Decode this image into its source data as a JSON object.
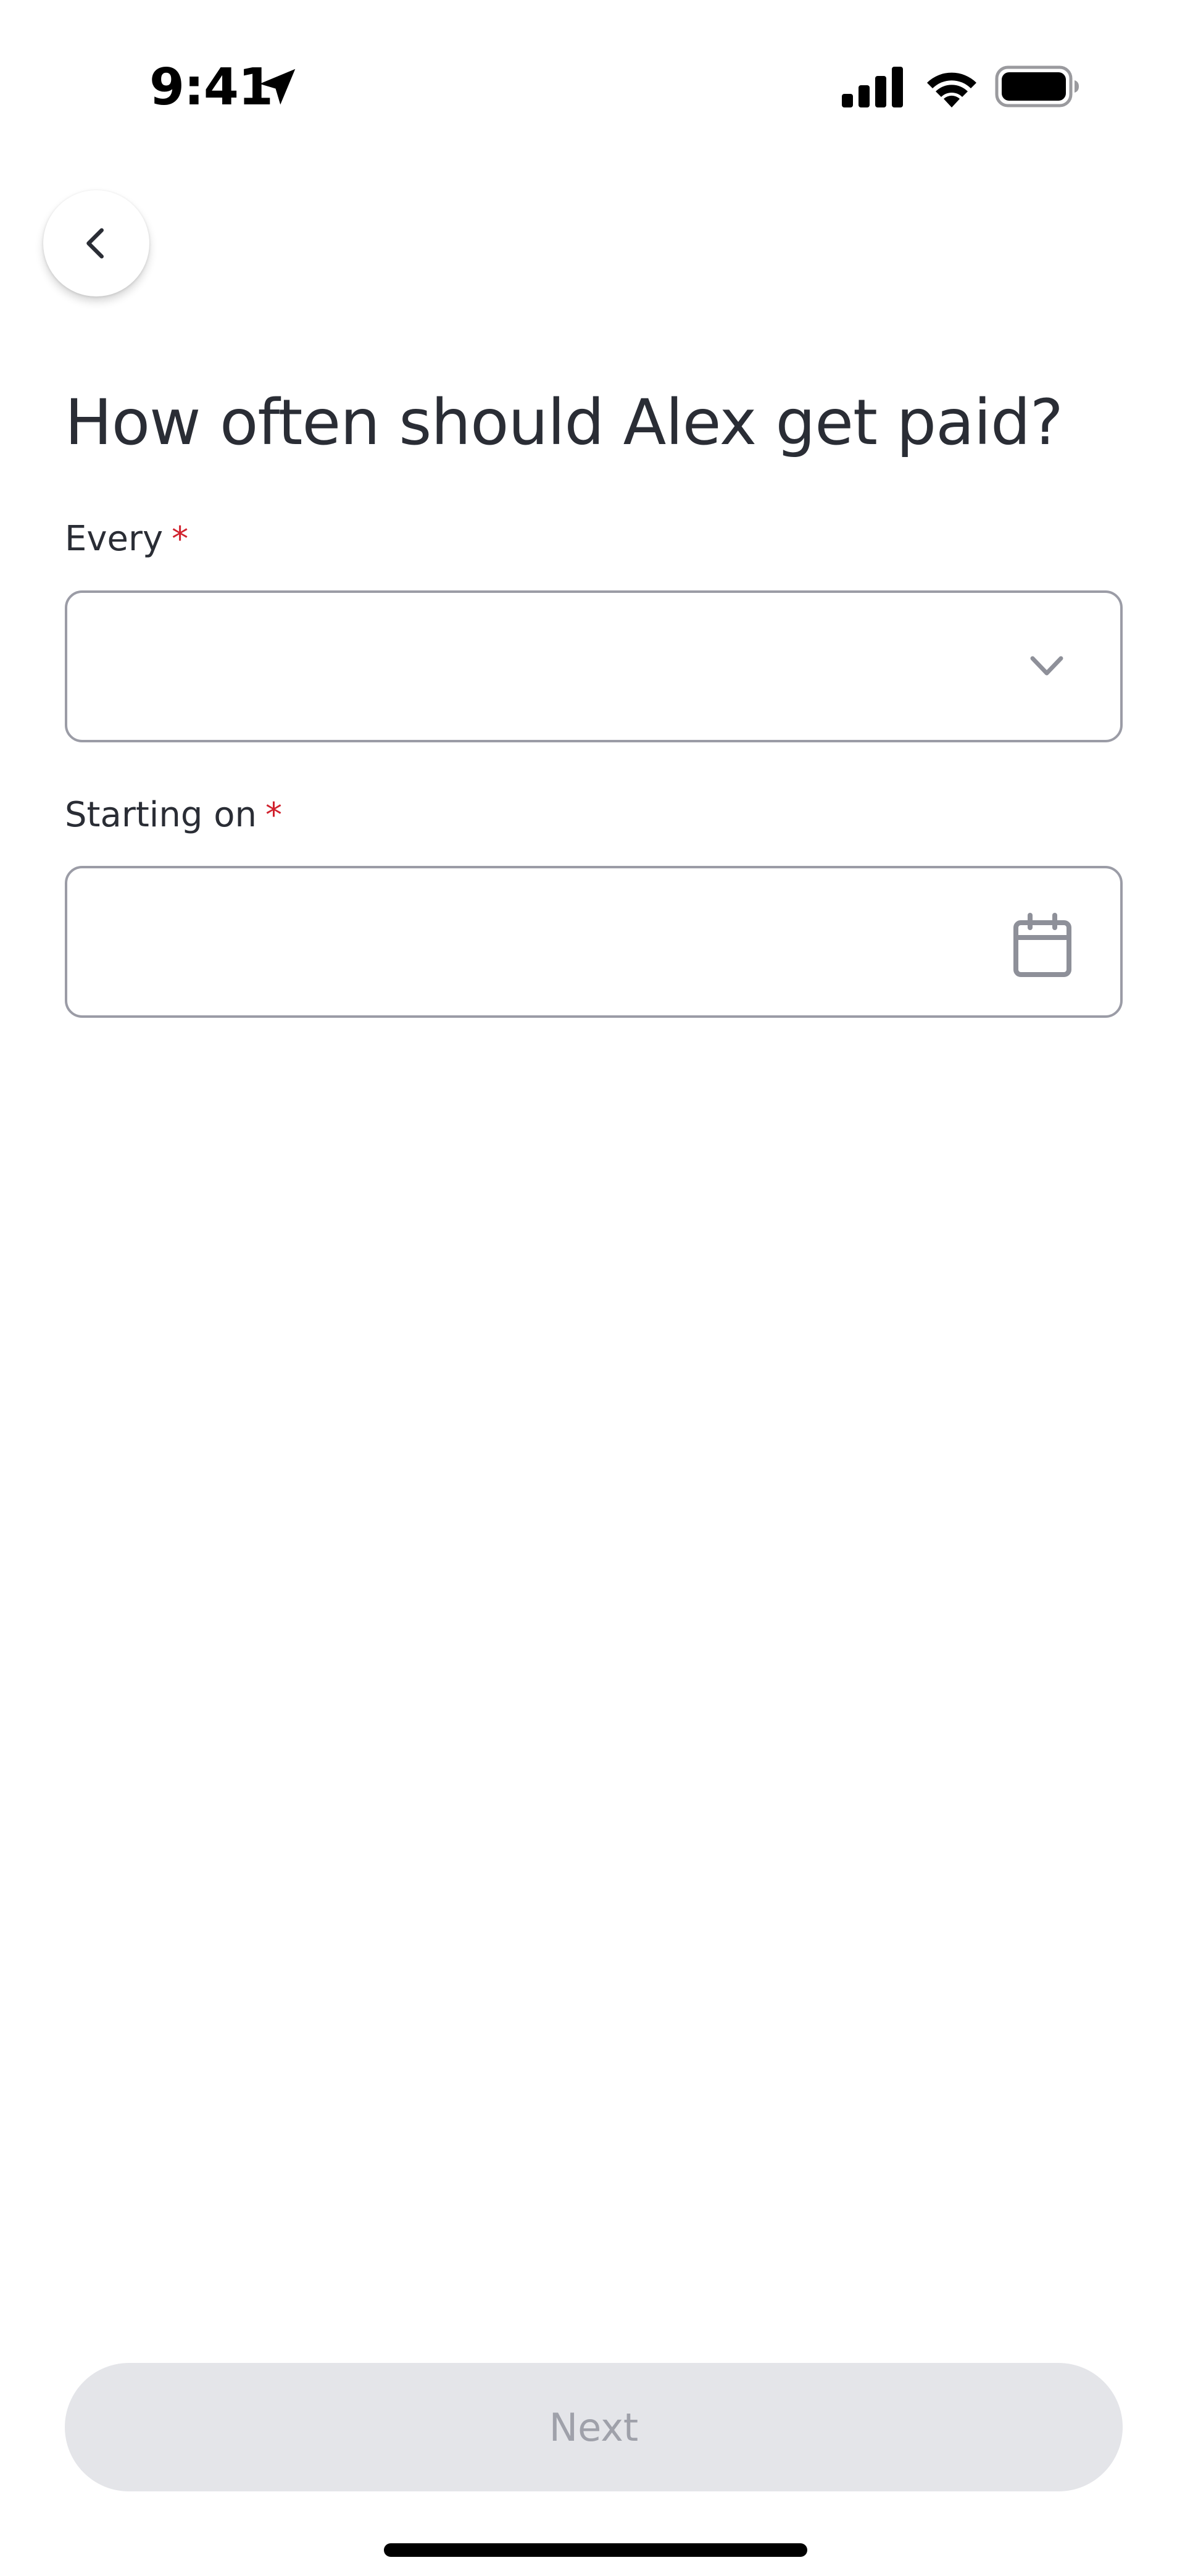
{
  "status_bar": {
    "time": "9:41",
    "icons": [
      "location-arrow-icon",
      "cellular-signal-icon",
      "wifi-icon",
      "battery-icon"
    ]
  },
  "navigation": {
    "back_icon": "chevron-left-icon"
  },
  "page": {
    "title": "How often should Alex get paid?"
  },
  "form": {
    "every": {
      "label": "Every",
      "required_marker": "*",
      "value": "",
      "icon": "chevron-down-icon"
    },
    "starting_on": {
      "label": "Starting on",
      "required_marker": "*",
      "value": "",
      "icon": "calendar-icon"
    }
  },
  "footer": {
    "next_label": "Next",
    "next_enabled": false
  },
  "colors": {
    "text_primary": "#2a2d35",
    "required": "#d1222e",
    "field_border": "#9b9ca6",
    "button_disabled_bg": "#e4e5e9",
    "button_disabled_text": "#9fa1aa",
    "icon_gray": "#8e9099"
  }
}
